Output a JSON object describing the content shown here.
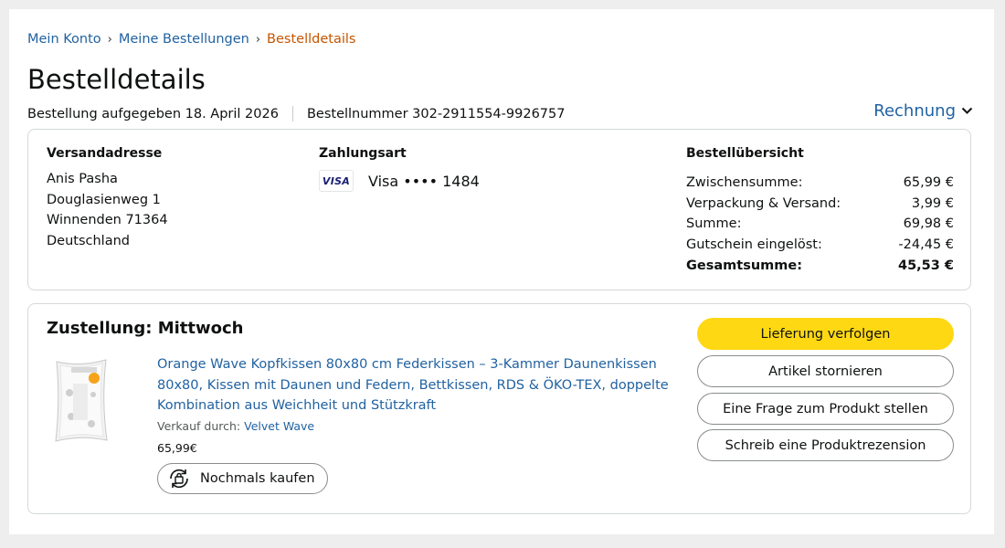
{
  "breadcrumb": {
    "items": [
      "Mein Konto",
      "Meine Bestellungen"
    ],
    "current": "Bestelldetails",
    "separator": "›"
  },
  "page_title": "Bestelldetails",
  "order_meta": {
    "placed": "Bestellung aufgegeben 18. April 2026",
    "number": "Bestellnummer 302-2911554-9926757"
  },
  "invoice_label": "Rechnung",
  "shipping": {
    "heading": "Versandadresse",
    "lines": [
      "Anis Pasha",
      "Douglasienweg 1",
      "Winnenden 71364",
      "Deutschland"
    ]
  },
  "payment": {
    "heading": "Zahlungsart",
    "badge": "VISA",
    "card": "Visa •••• 1484"
  },
  "summary": {
    "heading": "Bestellübersicht",
    "rows": [
      {
        "label": "Zwischensumme:",
        "value": "65,99 €"
      },
      {
        "label": "Verpackung & Versand:",
        "value": "3,99 €"
      },
      {
        "label": "Summe:",
        "value": "69,98 €"
      },
      {
        "label": "Gutschein eingelöst:",
        "value": "-24,45 €"
      },
      {
        "label": "Gesamtsumme:",
        "value": "45,53 €"
      }
    ]
  },
  "delivery": {
    "title": "Zustellung: Mittwoch",
    "product_title": "Orange Wave Kopfkissen 80x80 cm Federkissen – 3-Kammer Daunenkissen 80x80, Kissen mit Daunen und Federn, Bettkissen, RDS & ÖKO-TEX, doppelte Kombination aus Weichheit und Stützkraft",
    "seller_label": "Verkauf durch:",
    "seller_name": "Velvet Wave",
    "price": "65,99€",
    "rebuy_label": "Nochmals kaufen"
  },
  "actions": {
    "track": "Lieferung verfolgen",
    "cancel": "Artikel stornieren",
    "question": "Eine Frage zum Produkt stellen",
    "review": "Schreib eine Produktrezension"
  },
  "colors": {
    "link": "#2162a1",
    "current_crumb": "#c45500",
    "primary_button": "#ffd814",
    "border": "#d5d9d9"
  }
}
